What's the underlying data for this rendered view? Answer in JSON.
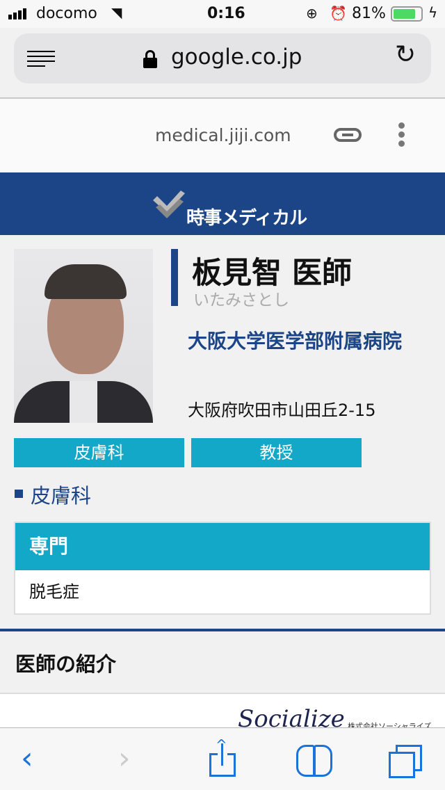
{
  "status_bar": {
    "carrier": "docomo",
    "time": "0:16",
    "battery": "81%"
  },
  "browser": {
    "url": "google.co.jp",
    "amp_domain": "medical.jiji.com"
  },
  "site": {
    "logo_text": "時事メディカル",
    "brand_color": "#1b4586",
    "accent_color": "#13a8c8"
  },
  "doctor": {
    "name": "板見智 医師",
    "kana": "いたみさとし",
    "hospital": "大阪大学医学部附属病院",
    "address": "大阪府吹田市山田丘2-15",
    "tags": [
      "皮膚科",
      "教授"
    ],
    "department": "皮膚科"
  },
  "specialty": {
    "header": "専門",
    "value": "脱毛症"
  },
  "intro": {
    "title": "医師の紹介"
  },
  "ad": {
    "brand": "Socialize",
    "company": "株式会社ソーシャライズ"
  }
}
